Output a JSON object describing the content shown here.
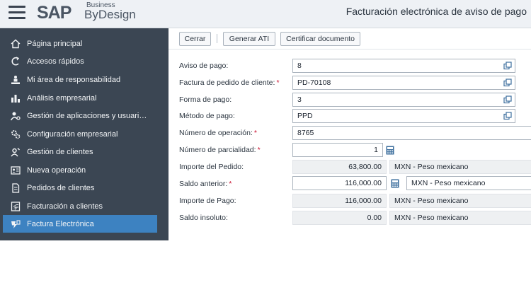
{
  "header": {
    "logo_main": "SAP",
    "logo_business": "Business",
    "logo_bydesign": "ByDesign",
    "page_title": "Facturación electrónica de aviso de pago"
  },
  "sidebar": {
    "items": [
      {
        "label": "Página principal",
        "icon": "home-icon"
      },
      {
        "label": "Accesos rápidos",
        "icon": "quick-access-icon"
      },
      {
        "label": "Mi área de responsabilidad",
        "icon": "responsibility-icon"
      },
      {
        "label": "Análisis empresarial",
        "icon": "bar-chart-icon"
      },
      {
        "label": "Gestión de aplicaciones y usuari…",
        "icon": "user-settings-icon"
      },
      {
        "label": "Configuración empresarial",
        "icon": "gears-icon"
      },
      {
        "label": "Gestión de clientes",
        "icon": "customer-icon"
      },
      {
        "label": "Nueva operación",
        "icon": "id-card-icon"
      },
      {
        "label": "Pedidos de clientes",
        "icon": "document-icon"
      },
      {
        "label": "Facturación a clientes",
        "icon": "invoice-icon"
      },
      {
        "label": "Factura Electrónica",
        "icon": "electronic-invoice-icon"
      }
    ],
    "active_index": 10
  },
  "toolbar": {
    "close_label": "Cerrar",
    "generate_label": "Generar ATI",
    "certify_label": "Certificar documento"
  },
  "form": {
    "aviso_pago": {
      "label": "Aviso de pago:",
      "value": "8"
    },
    "factura_pedido": {
      "label": "Factura de pedido de cliente:",
      "value": "PD-70108"
    },
    "forma_pago": {
      "label": "Forma de pago:",
      "value": "3"
    },
    "metodo_pago": {
      "label": "Método de pago:",
      "value": "PPD"
    },
    "numero_operacion": {
      "label": "Número de operación:",
      "value": "8765"
    },
    "numero_parcialidad": {
      "label": "Número de parcialidad:",
      "value": "1"
    },
    "importe_pedido": {
      "label": "Importe del Pedido:",
      "value": "63,800.00",
      "currency": "MXN - Peso mexicano"
    },
    "saldo_anterior": {
      "label": "Saldo anterior:",
      "value": "116,000.00",
      "currency": "MXN - Peso mexicano"
    },
    "importe_pago": {
      "label": "Importe de Pago:",
      "value": "116,000.00",
      "currency": "MXN - Peso mexicano"
    },
    "saldo_insoluto": {
      "label": "Saldo insoluto:",
      "value": "0.00",
      "currency": "MXN - Peso mexicano"
    }
  },
  "colors": {
    "sidebar_bg": "#3b4653",
    "active_item": "#3d82c1",
    "required_marker": "#c8102e",
    "header_bg": "#eef1f5"
  }
}
